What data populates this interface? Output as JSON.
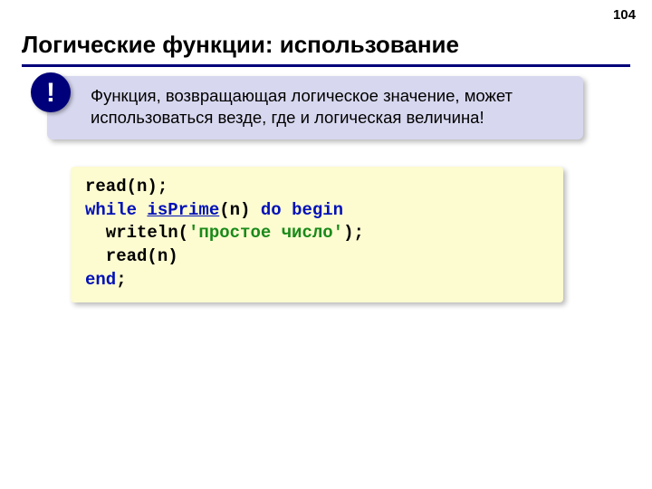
{
  "page_number": "104",
  "title": "Логические функции: использование",
  "callout": {
    "bang": "!",
    "text": "Функция, возвращающая логическое значение, может использоваться везде, где и логическая величина!"
  },
  "code": {
    "line1_a": "read(n);",
    "line2_kw1": "while",
    "line2_sp1": " ",
    "line2_fn": "isPrime",
    "line2_mid": "(n) ",
    "line2_kw2": "do",
    "line2_sp2": " ",
    "line2_kw3": "begin",
    "line3_a": "  writeln(",
    "line3_str": "'простое число'",
    "line3_b": ");",
    "line4_a": "  read(n)",
    "line5_kw": "end",
    "line5_b": ";"
  }
}
